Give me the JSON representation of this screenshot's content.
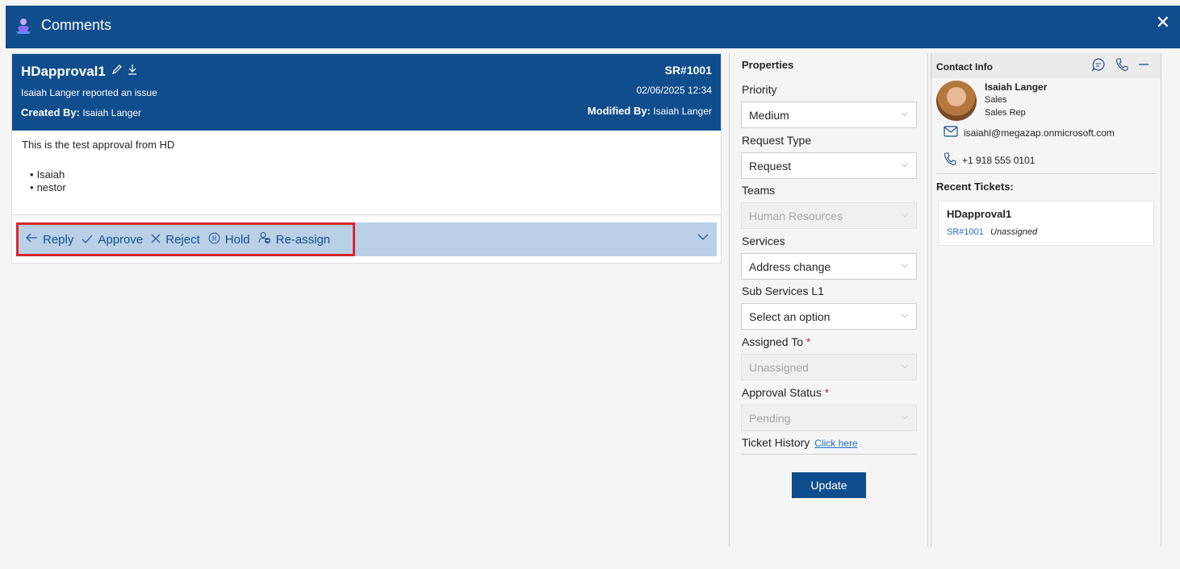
{
  "window": {
    "title": "Comments",
    "close_glyph": "✕"
  },
  "ticket": {
    "name": "HDapproval1",
    "sr": "SR#1001",
    "reported": "Isaiah Langer reported an issue",
    "date": "02/06/2025 12:34",
    "created_label": "Created By:",
    "created_by": "Isaiah Langer",
    "modified_label": "Modified By:",
    "modified_by": "Isaiah Langer",
    "body_text": "This is the test approval from HD",
    "bullets": [
      "Isaiah",
      "nestor"
    ]
  },
  "actions": {
    "reply": "Reply",
    "approve": "Approve",
    "reject": "Reject",
    "hold": "Hold",
    "reassign": "Re-assign"
  },
  "properties": {
    "title": "Properties",
    "priority_label": "Priority",
    "priority_value": "Medium",
    "request_type_label": "Request Type",
    "request_type_value": "Request",
    "teams_label": "Teams",
    "teams_value": "Human Resources",
    "services_label": "Services",
    "services_value": "Address change",
    "sub_services_label": "Sub Services L1",
    "sub_services_value": "Select an option",
    "assigned_label": "Assigned To",
    "assigned_value": "Unassigned",
    "approval_label": "Approval Status",
    "approval_value": "Pending",
    "required_mark": "*",
    "history_label": "Ticket History",
    "history_link": "Click here",
    "update_button": "Update"
  },
  "contact": {
    "title": "Contact Info",
    "name": "Isaiah Langer",
    "department": "Sales",
    "role": "Sales Rep",
    "email": "isaiahl@megazap.onmicrosoft.com",
    "phone": "+1 918 555 0101",
    "recent_label": "Recent Tickets:",
    "recent": {
      "name": "HDapproval1",
      "sr": "SR#1001",
      "status": "Unassigned"
    }
  },
  "colors": {
    "header_blue": "#0f4d8c",
    "action_bar": "#b9d0e6",
    "highlight_red": "#d8262c",
    "link_blue": "#1e6fc5"
  }
}
